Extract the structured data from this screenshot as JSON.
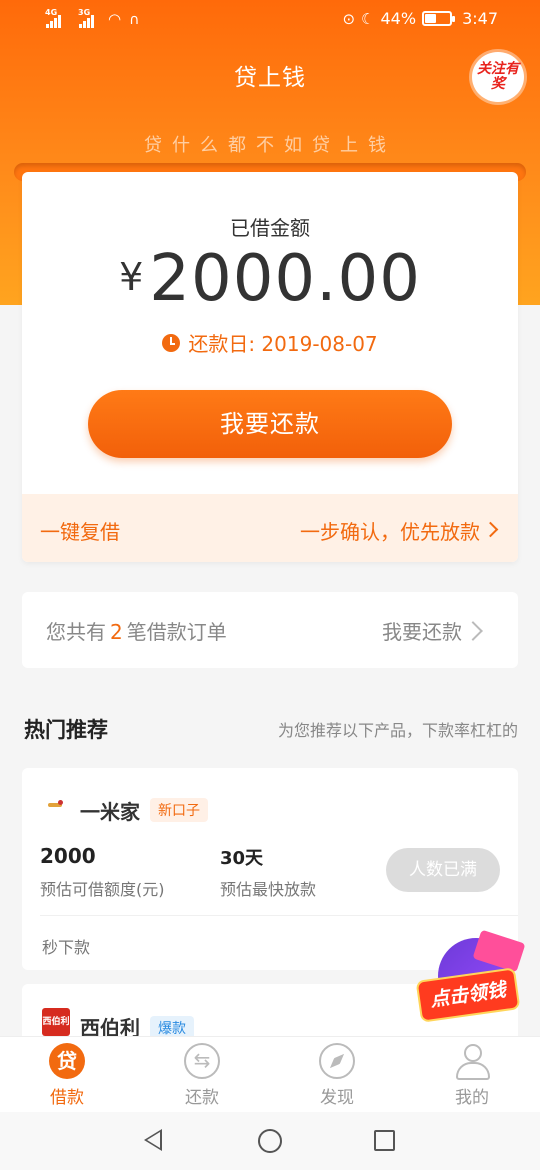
{
  "status_bar": {
    "net1": "4G",
    "net2": "3G",
    "battery": "44%",
    "battery_level": 0.44,
    "time": "3:47"
  },
  "header": {
    "title": "贷上钱",
    "promo_badge": "关注有奖",
    "slogan": "贷什么都不如贷上钱"
  },
  "loan_card": {
    "label": "已借金额",
    "currency": "¥",
    "amount": "2000.00",
    "due_date": "还款日: 2019-08-07",
    "repay_button": "我要还款",
    "reborrow_left": "一键复借",
    "reborrow_right": "一步确认，优先放款"
  },
  "orders": {
    "prefix": "您共有",
    "count": "2",
    "suffix": "笔借款订单",
    "action": "我要还款"
  },
  "recommend": {
    "title": "热门推荐",
    "subtitle": "为您推荐以下产品，下款率杠杠的"
  },
  "products": [
    {
      "name": "一米家",
      "tag": "新口子",
      "amount": "2000",
      "amount_label": "预估可借额度(元)",
      "days": "30天",
      "days_label": "预估最快放款",
      "button": "人数已满",
      "footer": "秒下款"
    },
    {
      "name": "西伯利",
      "tag": "爆款",
      "logo_text": "西伯利"
    }
  ],
  "floating_promo": {
    "label": "点击领钱"
  },
  "tabbar": [
    {
      "label": "借款",
      "icon_text": "贷",
      "active": true
    },
    {
      "label": "还款",
      "active": false
    },
    {
      "label": "发现",
      "active": false
    },
    {
      "label": "我的",
      "active": false
    }
  ],
  "colors": {
    "accent": "#f26a10",
    "header_gradient_top": "#ff6a0a",
    "header_gradient_bottom": "#ffa41f"
  }
}
